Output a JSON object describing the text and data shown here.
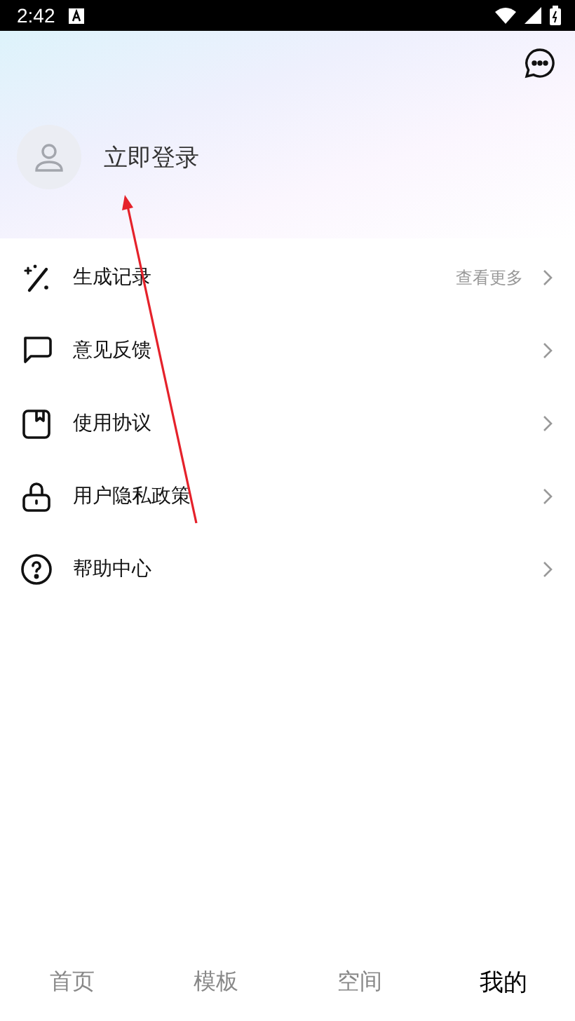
{
  "status_bar": {
    "time": "2:42"
  },
  "profile": {
    "login": "立即登录"
  },
  "menu": [
    {
      "label": "生成记录",
      "more": "查看更多"
    },
    {
      "label": "意见反馈"
    },
    {
      "label": "使用协议"
    },
    {
      "label": "用户隐私政策"
    },
    {
      "label": "帮助中心"
    }
  ],
  "tabs": [
    {
      "label": "首页",
      "selected": false
    },
    {
      "label": "模板",
      "selected": false
    },
    {
      "label": "空间",
      "selected": false
    },
    {
      "label": "我的",
      "selected": true
    }
  ]
}
